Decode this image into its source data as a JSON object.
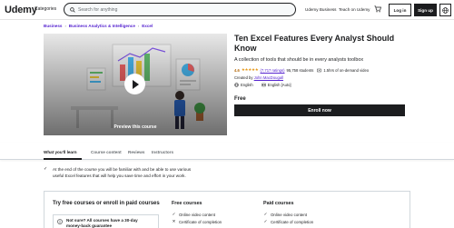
{
  "header": {
    "logo": "Udemy",
    "categories": "Categories",
    "search_placeholder": "Search for anything",
    "nav_business": "Udemy Business",
    "nav_teach": "Teach on Udemy",
    "login": "Log in",
    "signup": "Sign up"
  },
  "breadcrumb": [
    "Business",
    "Business Analytics & Intelligence",
    "Excel"
  ],
  "hero": {
    "preview_label": "Preview this course"
  },
  "course": {
    "title": "Ten Excel Features Every Analyst Should Know",
    "subtitle": "A collection of tools that should be in every analysts toolbox",
    "rating": "4.6",
    "stars": "★★★★★",
    "rating_count": "(7,717 ratings)",
    "students": "95,758 students",
    "duration": "1.5hrs of on-demand video",
    "created_by_label": "Created by",
    "author": "John MacDougall",
    "language": "English",
    "captions": "English [Auto]",
    "price": "Free",
    "enroll_label": "Enroll now"
  },
  "tabs": {
    "items": [
      "What you'll learn",
      "Course content",
      "Reviews",
      "Instructors"
    ],
    "active": 0
  },
  "learn": {
    "line1": "At the end of the course you will be familiar with and be able to use various",
    "line2": "useful Excel features that will help you save time and effort in your work."
  },
  "compare": {
    "title": "Try free courses or enroll in paid courses",
    "card_line1": "Not sure? All courses have a 30-day",
    "card_line2": "money-back guarantee",
    "free": {
      "title": "Free courses",
      "items": [
        "Online video content",
        "Certificate of completion"
      ]
    },
    "paid": {
      "title": "Paid courses",
      "items": [
        "Online video content",
        "Certificate of completion"
      ]
    }
  },
  "colors": {
    "brand_purple": "#a435f0",
    "link_purple": "#5624d0",
    "dark": "#1c1d1f",
    "star": "#e59819"
  }
}
